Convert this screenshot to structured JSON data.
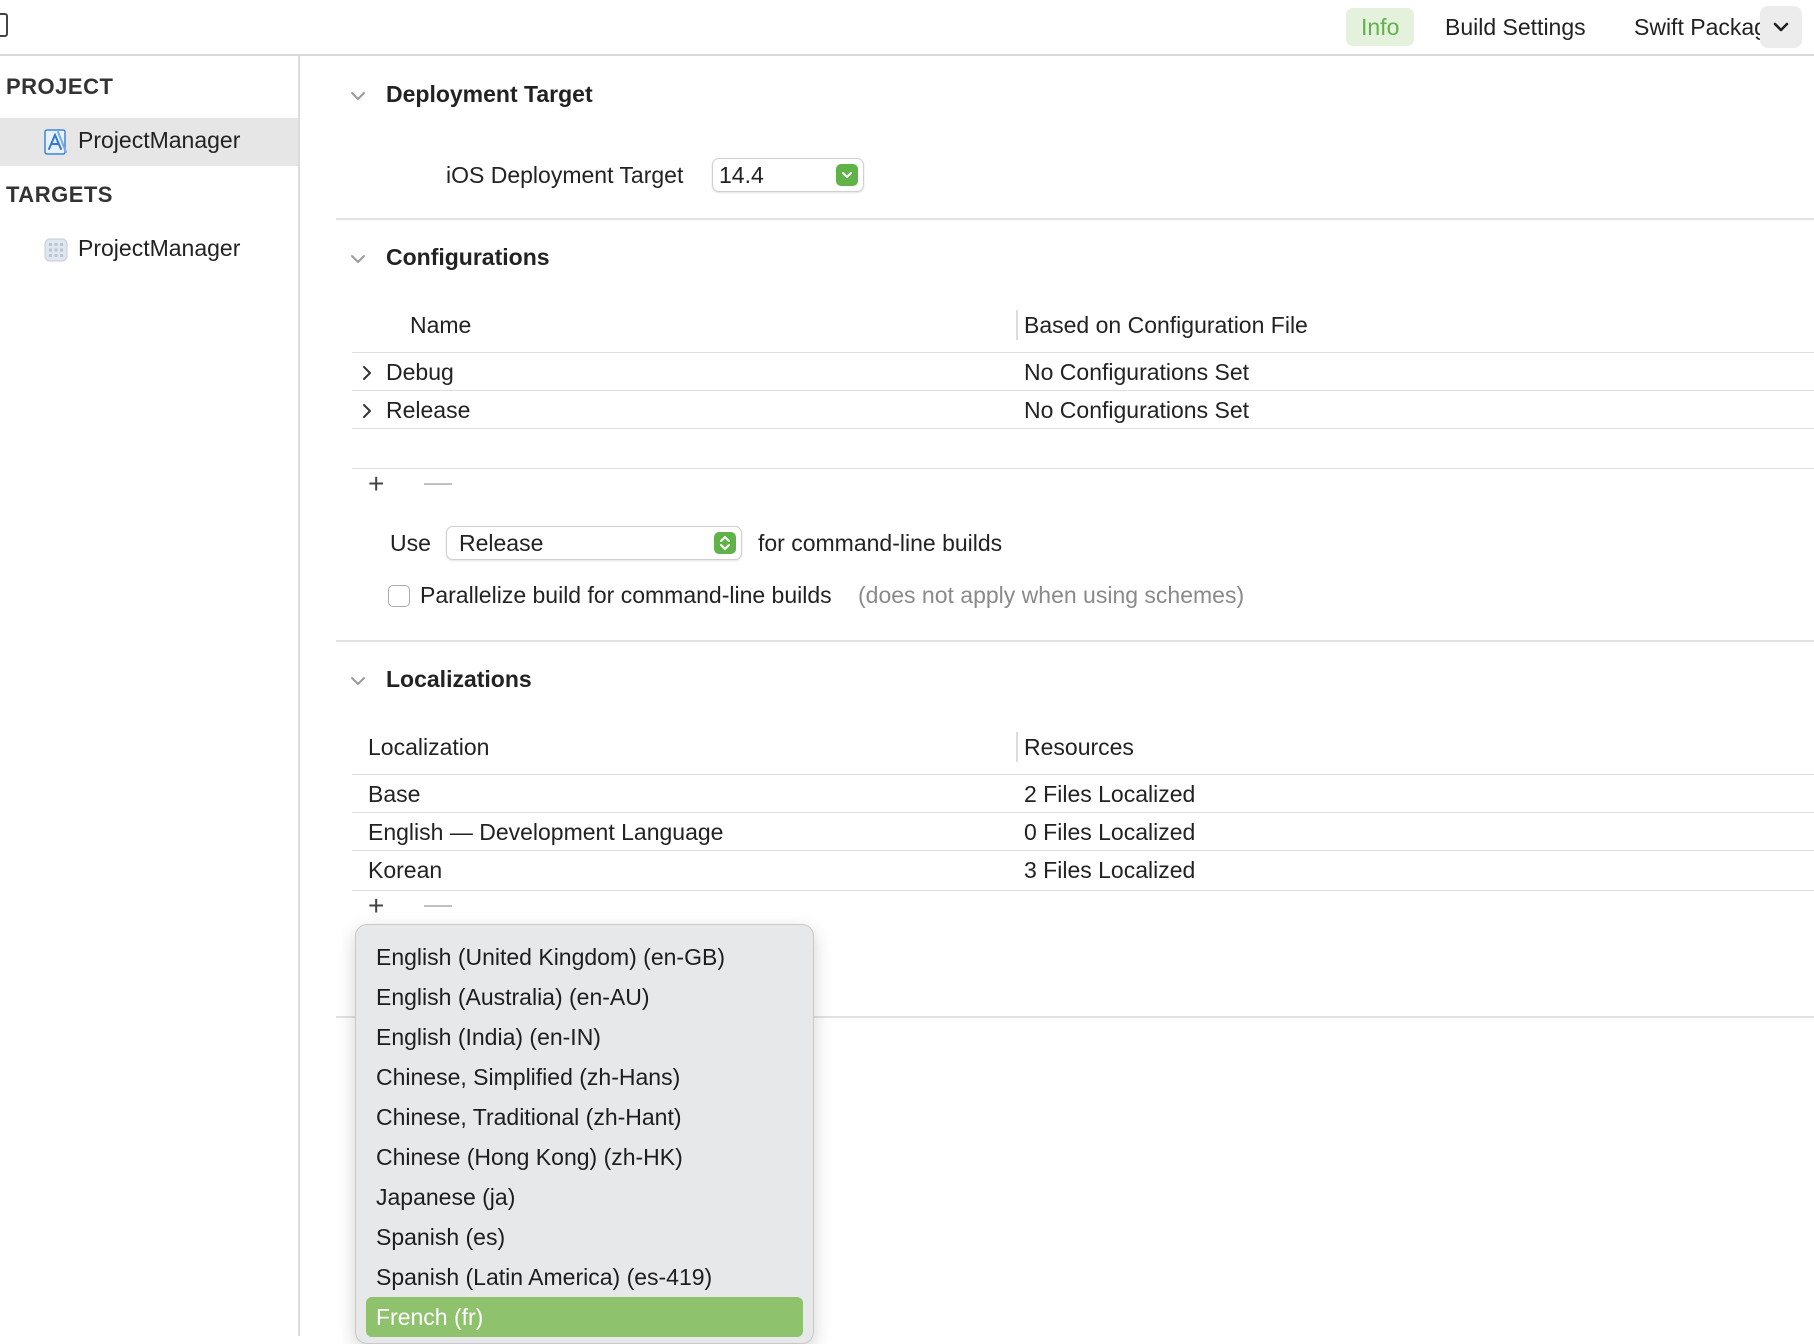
{
  "tabs": {
    "info": "Info",
    "build_settings": "Build Settings",
    "swift_packages": "Swift Packages"
  },
  "sidebar": {
    "project_header": "PROJECT",
    "project_item": "ProjectManager",
    "targets_header": "TARGETS",
    "target_item": "ProjectManager"
  },
  "deployment": {
    "title": "Deployment Target",
    "ios_label": "iOS Deployment Target",
    "ios_value": "14.4"
  },
  "configurations": {
    "title": "Configurations",
    "col_name": "Name",
    "col_file": "Based on Configuration File",
    "rows": [
      {
        "name": "Debug",
        "file": "No Configurations Set"
      },
      {
        "name": "Release",
        "file": "No Configurations Set"
      }
    ],
    "use_label": "Use",
    "use_value": "Release",
    "use_suffix": "for command-line builds",
    "parallelize_label": "Parallelize build for command-line builds",
    "parallelize_note": "(does not apply when using schemes)",
    "parallelize_checked": false
  },
  "localizations": {
    "title": "Localizations",
    "col_localization": "Localization",
    "col_resources": "Resources",
    "rows": [
      {
        "name": "Base",
        "resources": "2 Files Localized"
      },
      {
        "name": "English — Development Language",
        "resources": "0 Files Localized"
      },
      {
        "name": "Korean",
        "resources": "3 Files Localized"
      }
    ]
  },
  "controls": {
    "plus": "+",
    "minus": "—"
  },
  "language_menu": {
    "items": [
      "English (United Kingdom) (en-GB)",
      "English (Australia) (en-AU)",
      "English (India) (en-IN)",
      "Chinese, Simplified (zh-Hans)",
      "Chinese, Traditional (zh-Hant)",
      "Chinese (Hong Kong) (zh-HK)",
      "Japanese (ja)",
      "Spanish (es)",
      "Spanish (Latin America) (es-419)",
      "French (fr)"
    ],
    "highlighted": "French (fr)"
  },
  "colors": {
    "accent": "#5fb349",
    "accent_bg": "#e3f1dd",
    "menu_highlight": "#8fc26d",
    "menu_bg": "#e7e8ea"
  }
}
